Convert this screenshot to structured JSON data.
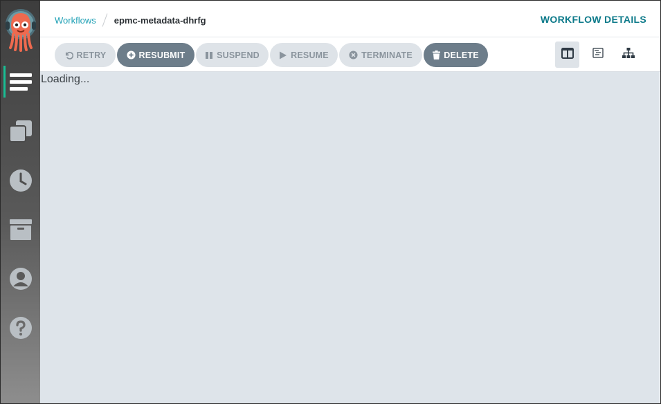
{
  "breadcrumb": {
    "parent": "Workflows",
    "current": "epmc-metadata-dhrfg"
  },
  "header": {
    "title": "WORKFLOW DETAILS"
  },
  "toolbar": {
    "retry": "RETRY",
    "resubmit": "RESUBMIT",
    "suspend": "SUSPEND",
    "resume": "RESUME",
    "terminate": "TERMINATE",
    "delete": "DELETE"
  },
  "sidebar": {
    "items": [
      {
        "name": "workflows",
        "icon": "list-icon",
        "active": true
      },
      {
        "name": "workflow-templates",
        "icon": "stacked-windows-icon",
        "active": false
      },
      {
        "name": "cron-workflows",
        "icon": "clock-icon",
        "active": false
      },
      {
        "name": "archived-workflows",
        "icon": "archive-icon",
        "active": false
      },
      {
        "name": "user",
        "icon": "user-icon",
        "active": false
      },
      {
        "name": "help",
        "icon": "help-icon",
        "active": false
      }
    ]
  },
  "views": [
    {
      "name": "split-view",
      "icon": "columns-icon",
      "active": true
    },
    {
      "name": "timeline-view",
      "icon": "timeline-icon",
      "active": false
    },
    {
      "name": "graph-view",
      "icon": "sitemap-icon",
      "active": false
    }
  ],
  "main": {
    "status_text": "Loading..."
  },
  "colors": {
    "accent": "#18be94",
    "link": "#1ea0b5",
    "title": "#0d7a8a",
    "button_dark": "#6d7d8a",
    "button_light": "#dee3e8"
  }
}
